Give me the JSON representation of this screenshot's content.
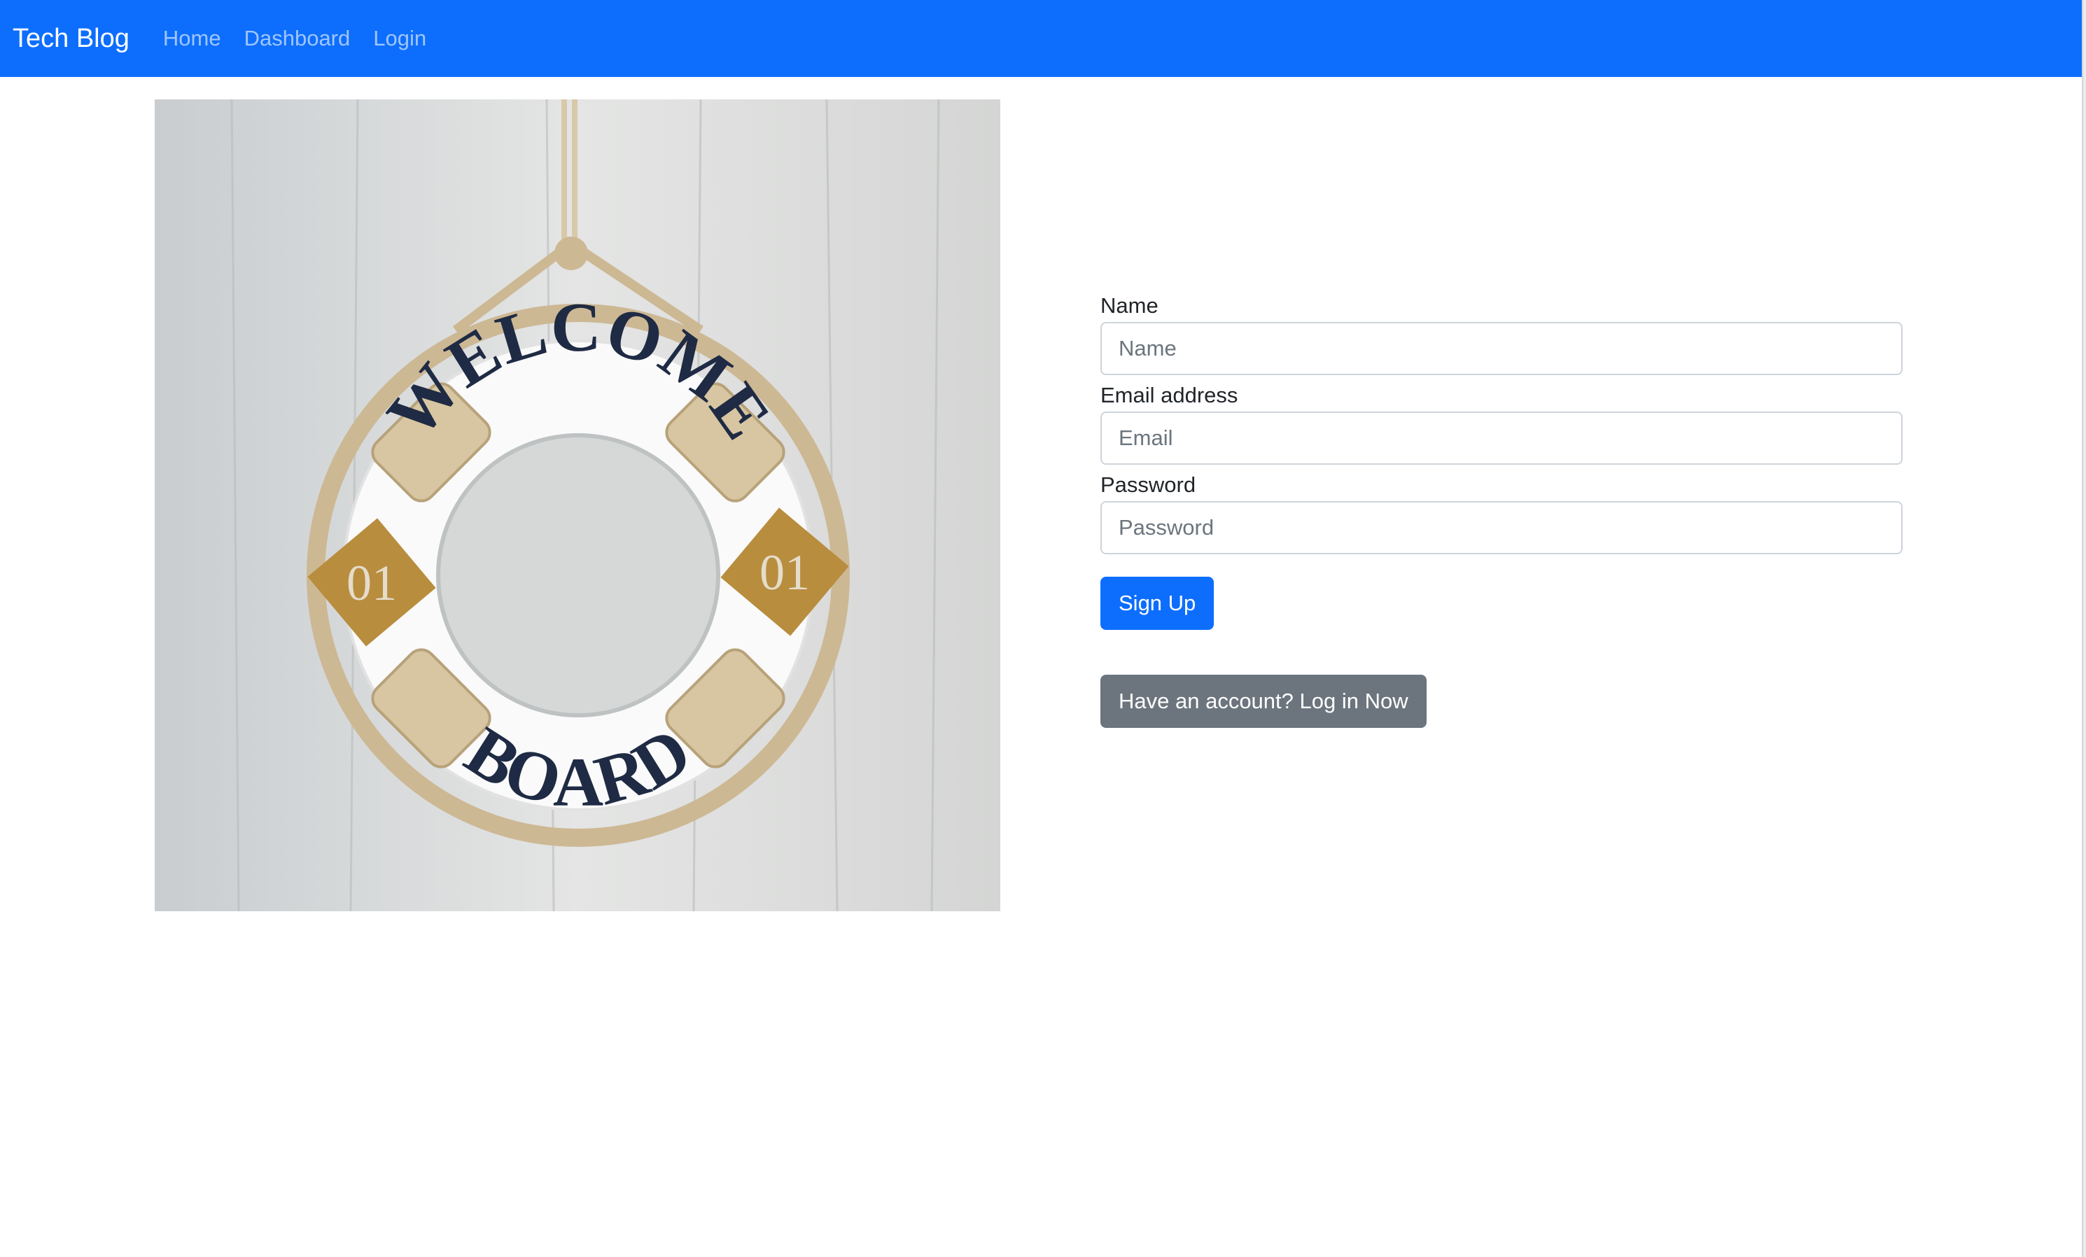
{
  "navbar": {
    "brand": "Tech Blog",
    "links": [
      "Home",
      "Dashboard",
      "Login"
    ]
  },
  "hero": {
    "image_alt": "Welcome Board life ring hanging on wooden wall",
    "ring_top_text": "WELCOME",
    "ring_bottom_text": "BOARD",
    "patch_text": "01"
  },
  "form": {
    "name_label": "Name",
    "name_placeholder": "Name",
    "email_label": "Email address",
    "email_placeholder": "Email",
    "password_label": "Password",
    "password_placeholder": "Password",
    "signup_button": "Sign Up",
    "login_button": "Have an account? Log in Now"
  },
  "colors": {
    "primary": "#0d6efd",
    "secondary": "#6c757d"
  }
}
